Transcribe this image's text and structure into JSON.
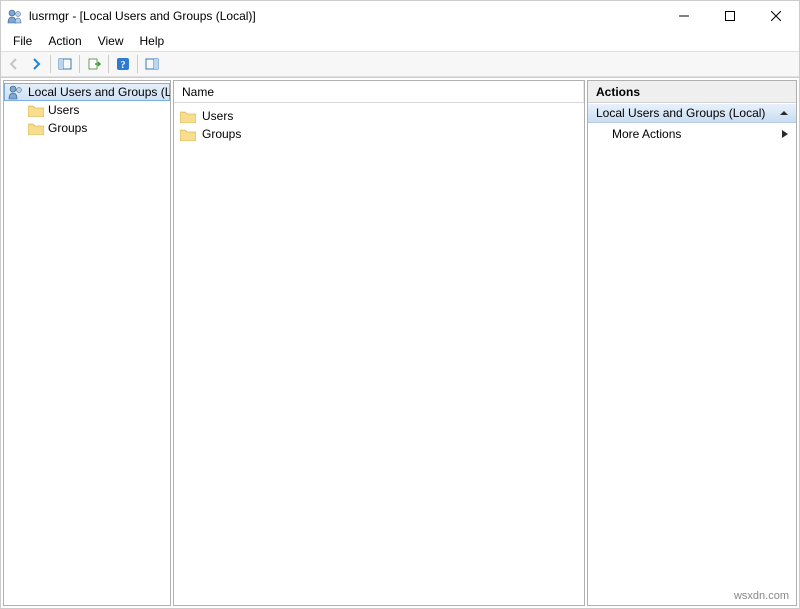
{
  "window": {
    "title": "lusrmgr - [Local Users and Groups (Local)]"
  },
  "menubar": {
    "file": "File",
    "action": "Action",
    "view": "View",
    "help": "Help"
  },
  "tree": {
    "root": "Local Users and Groups (Local)",
    "children": [
      {
        "label": "Users"
      },
      {
        "label": "Groups"
      }
    ]
  },
  "list": {
    "columns": {
      "name": "Name"
    },
    "rows": [
      {
        "name": "Users"
      },
      {
        "name": "Groups"
      }
    ]
  },
  "actions": {
    "header": "Actions",
    "section": "Local Users and Groups (Local)",
    "more": "More Actions"
  },
  "watermark": "wsxdn.com"
}
